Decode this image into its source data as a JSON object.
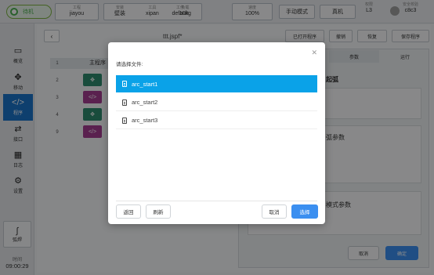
{
  "topbar": {
    "status": "待机",
    "project_label": "工程",
    "project_value": "jiayou",
    "install_label": "安装",
    "install_value": "壁装",
    "tool_label": "工具",
    "tool_value": "xipan",
    "load_label": "负载",
    "load_value": "10kg",
    "workpiece_label": "工件",
    "workpiece_value": "default",
    "speed_label": "速度",
    "speed_value": "100%",
    "mode_button": "手动模式",
    "real_button": "真机",
    "level_label": "权限",
    "level_value": "L3",
    "safety_label": "安全校验",
    "safety_value": "c8c3"
  },
  "sidebar": {
    "items": [
      {
        "label": "概览",
        "icon": "monitor-icon"
      },
      {
        "label": "移动",
        "icon": "move-icon"
      },
      {
        "label": "程序",
        "icon": "code-icon"
      },
      {
        "label": "接口",
        "icon": "interface-icon"
      },
      {
        "label": "日志",
        "icon": "calendar-icon"
      },
      {
        "label": "设置",
        "icon": "gear-icon"
      }
    ],
    "weld_label": "弧焊",
    "time_label": "时间",
    "time_value": "09:00:29"
  },
  "program": {
    "file_title": "ttt.jspf*",
    "open_button": "已打开程序",
    "undo_button": "撤销",
    "redo_button": "恢复",
    "save_button": "保存程序",
    "main_header": "主程序",
    "row_numbers": [
      "1",
      "2",
      "3",
      "4",
      "9"
    ],
    "param_tab": "参数",
    "run_tab": "运行",
    "arc_title": "起弧",
    "arc_params": "弧参数",
    "mode_params": "模式参数",
    "cancel_button": "取消",
    "confirm_button": "确定"
  },
  "dialog": {
    "title": "请选择文件:",
    "files": [
      "arc_start1",
      "arc_start2",
      "arc_start3"
    ],
    "selected_index": 0,
    "back_button": "返回",
    "refresh_button": "刷新",
    "cancel_button": "取消",
    "select_button": "选择",
    "accent_color": "#0aa2e8"
  }
}
